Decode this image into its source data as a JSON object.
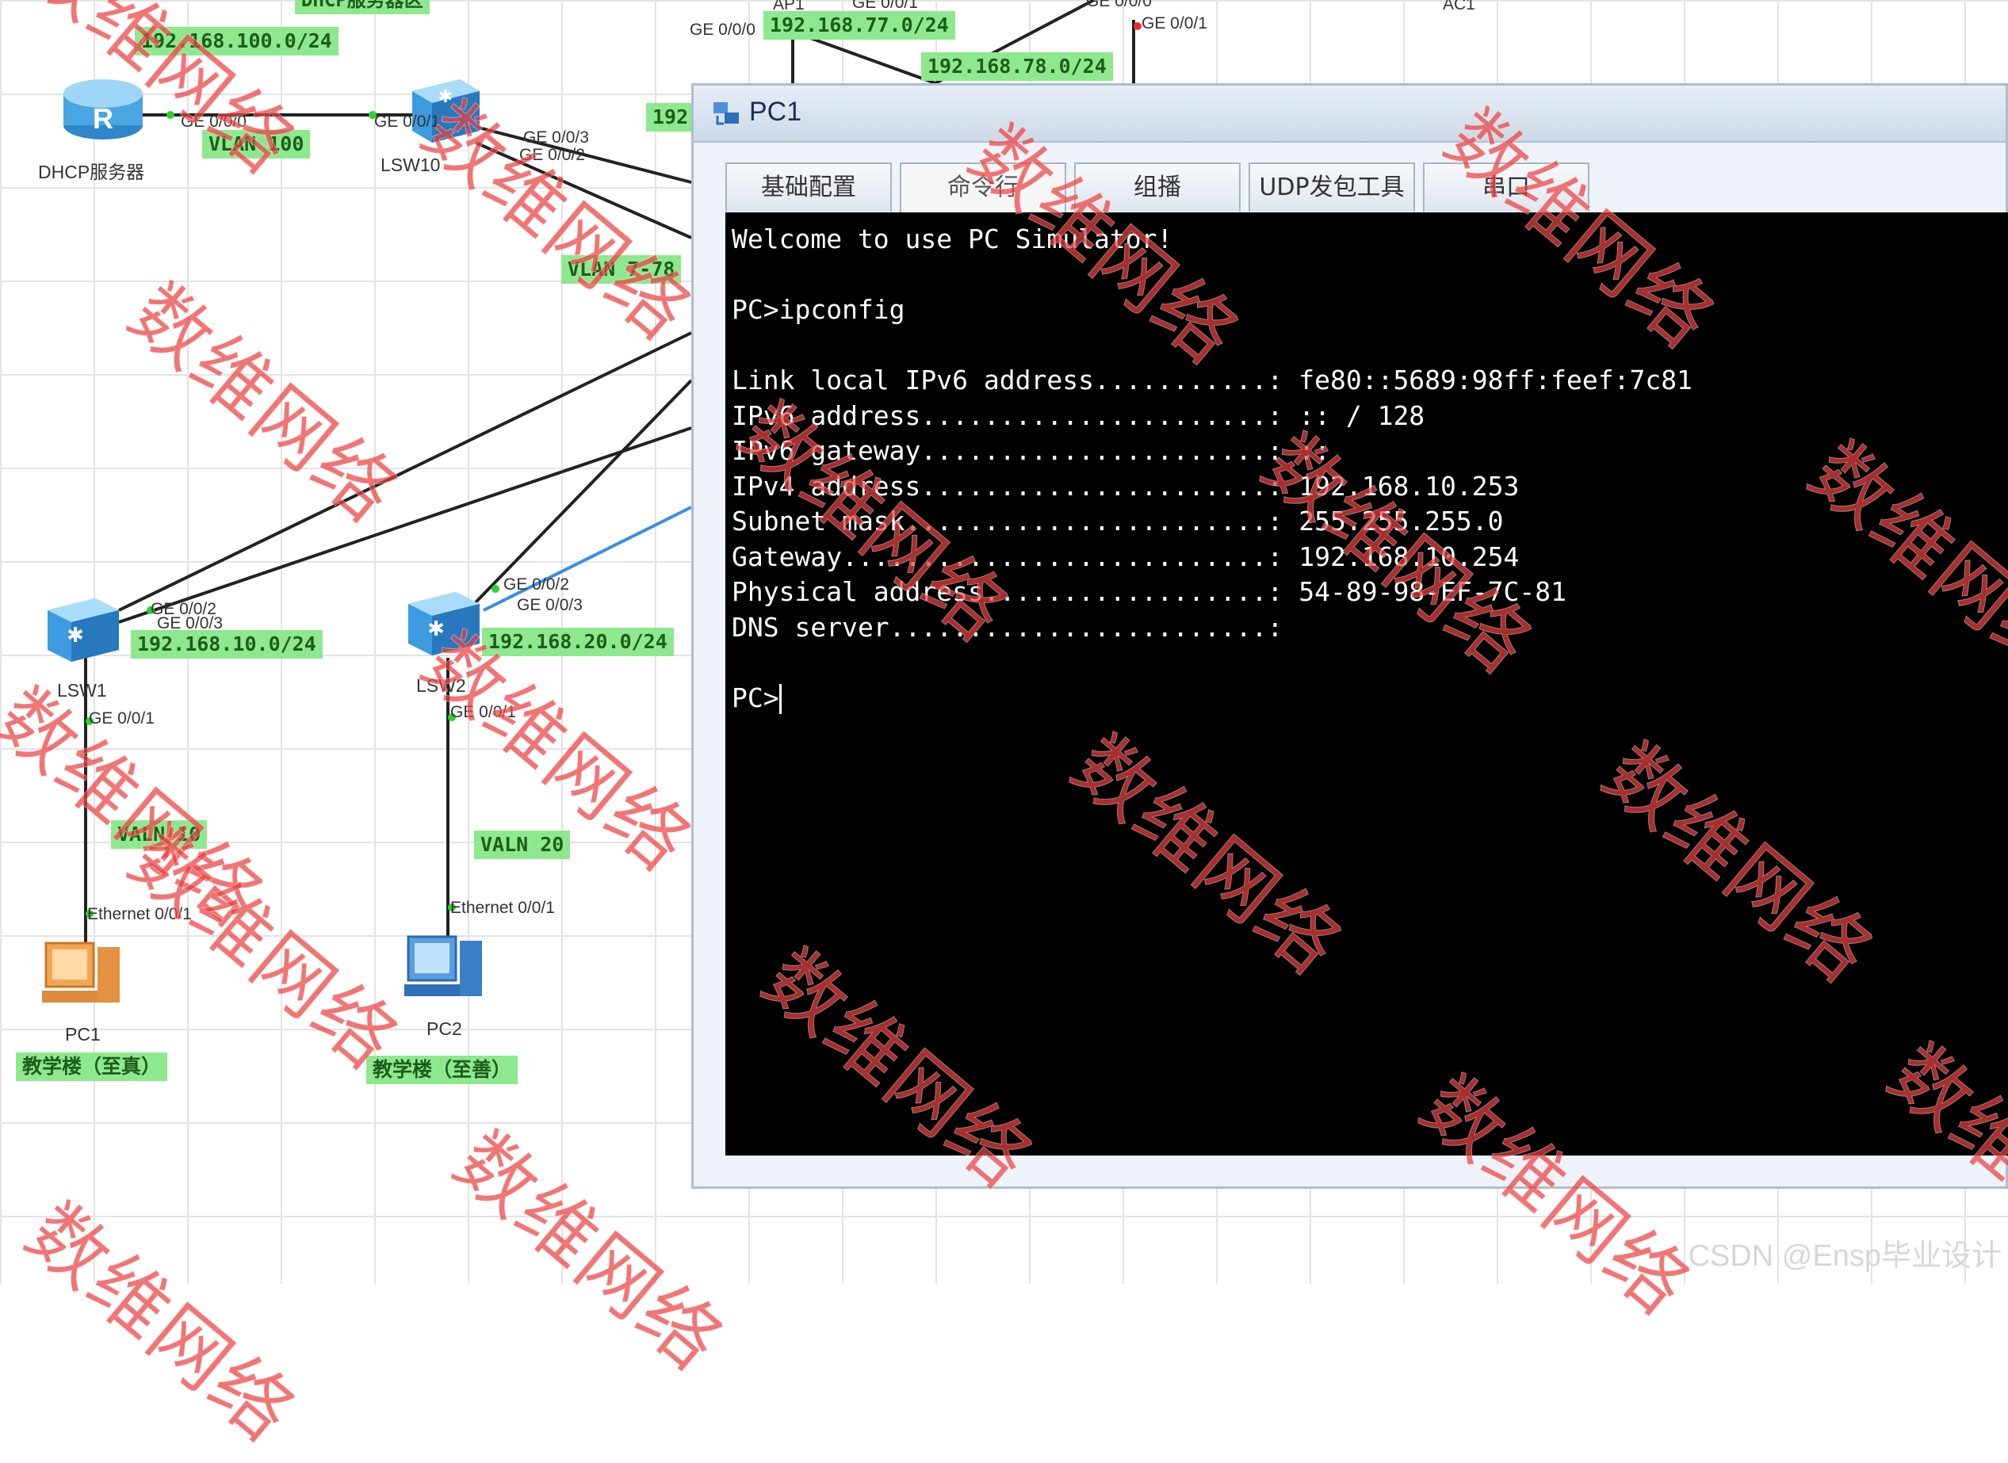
{
  "topology": {
    "top_labels": {
      "server_zone": "DHCP服务器区",
      "ap1": "AP1",
      "ac1": "AC1",
      "ge_000_top": "GE 0/0/0",
      "ge_001_top": "GE 0/0/1",
      "ge_001_right": "GE 0/0/1",
      "ge_000_right": "GE 0/0/0",
      "net_77": "192.168.77.0/24",
      "net_78": "192.168.78.0/24",
      "net_192_partial": "192"
    },
    "devices": {
      "dhcp_server": "DHCP服务器",
      "lsw10": "LSW10",
      "lsw1": "LSW1",
      "lsw2": "LSW2",
      "pc1": "PC1",
      "pc2": "PC2"
    },
    "networks": {
      "net_100": "192.168.100.0/24",
      "vlan_100": "VLAN 100",
      "vlan_partial": "VLAN 7-78",
      "net_10": "192.168.10.0/24",
      "net_20": "192.168.20.0/24",
      "valn_10": "VALN 10",
      "valn_20": "VALN 20",
      "building_1": "教学楼（至真）",
      "building_2": "教学楼（至善）"
    },
    "ports": {
      "dhcp_ge000": "GE 0/0/0",
      "lsw10_ge001": "GE 0/0/1",
      "lsw10_ge003": "GE 0/0/3",
      "lsw10_ge002": "GE 0/0/2",
      "lsw1_ge002": "GE 0/0/2",
      "lsw1_ge003": "GE 0/0/3",
      "lsw1_ge001": "GE 0/0/1",
      "lsw2_ge002": "GE 0/0/2",
      "lsw2_ge003": "GE 0/0/3",
      "lsw2_ge001": "GE 0/0/1",
      "pc1_eth": "Ethernet 0/0/1",
      "pc2_eth": "Ethernet 0/0/1"
    }
  },
  "window": {
    "title": "PC1",
    "tabs": [
      {
        "label": "基础配置"
      },
      {
        "label": "命令行"
      },
      {
        "label": "组播"
      },
      {
        "label": "UDP发包工具"
      },
      {
        "label": "串口"
      }
    ],
    "active_tab": "命令行",
    "terminal_lines": [
      "Welcome to use PC Simulator!",
      "",
      "PC>ipconfig",
      "",
      "Link local IPv6 address...........: fe80::5689:98ff:feef:7c81",
      "IPv6 address......................: :: / 128",
      "IPv6 gateway......................: ::",
      "IPv4 address......................: 192.168.10.253",
      "Subnet mask.......................: 255.255.255.0",
      "Gateway...........................: 192.168.10.254",
      "Physical address..................: 54-89-98-EF-7C-81",
      "DNS server........................:",
      "",
      "PC>"
    ]
  },
  "watermark_text": "数维网络",
  "footer_mark": "CSDN @Ensp毕业设计",
  "colors": {
    "label_bg": "#8ee88e",
    "watermark": "#ea4040",
    "terminal_bg": "#000000",
    "terminal_fg": "#ffffff"
  }
}
